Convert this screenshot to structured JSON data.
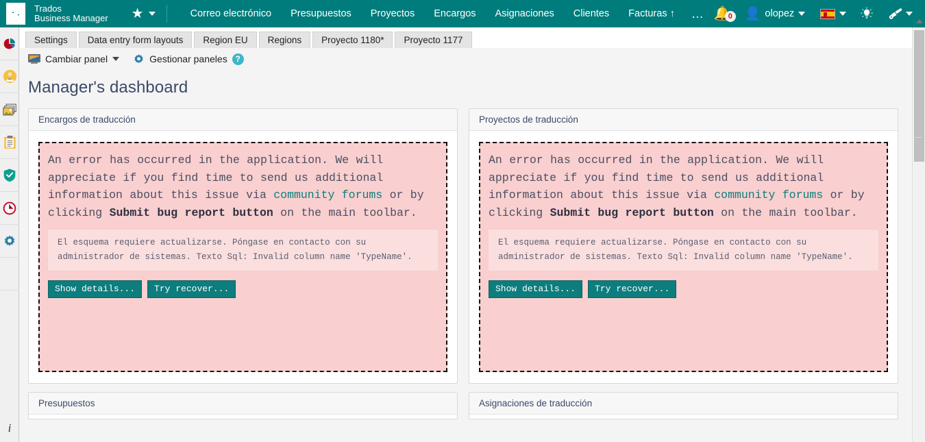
{
  "header": {
    "brand_line1": "Trados",
    "brand_line2": "Business Manager",
    "favorites_icon": "star-icon",
    "nav": [
      {
        "label": "Correo electrónico"
      },
      {
        "label": "Presupuestos"
      },
      {
        "label": "Proyectos"
      },
      {
        "label": "Encargos"
      },
      {
        "label": "Asignaciones"
      },
      {
        "label": "Clientes"
      },
      {
        "label": "Facturas ↑"
      }
    ],
    "overflow_label": "…",
    "notifications_count": "0",
    "username": "olopez",
    "language_flag": "spain-flag-icon",
    "idea_icon": "lightbulb-icon",
    "tools_icon": "paintbrush-icon",
    "help_icon": "question-mark-icon"
  },
  "sidebar": {
    "items": [
      {
        "name": "reports-pie-chart-icon"
      },
      {
        "name": "user-profile-icon"
      },
      {
        "name": "images-gallery-icon"
      },
      {
        "name": "clipboard-tasks-icon"
      },
      {
        "name": "shield-check-icon"
      },
      {
        "name": "clock-history-icon"
      },
      {
        "name": "settings-gear-icon"
      }
    ],
    "bottom_label": "i"
  },
  "tabs": [
    {
      "label": "Settings"
    },
    {
      "label": "Data entry form layouts"
    },
    {
      "label": "Region EU"
    },
    {
      "label": "Regions"
    },
    {
      "label": "Proyecto 1180*"
    },
    {
      "label": "Proyecto 1177"
    }
  ],
  "toolbar": {
    "change_panel_label": "Cambiar panel",
    "manage_panels_label": "Gestionar paneles",
    "help_label": "?"
  },
  "page": {
    "title": "Manager's dashboard"
  },
  "panels": {
    "top_left_title": "Encargos de traducción",
    "top_right_title": "Proyectos de traducción",
    "bottom_left_title": "Presupuestos",
    "bottom_right_title": "Asignaciones de traducción"
  },
  "error": {
    "text_part1": "An error has occurred in the application. We will appreciate if you find time to send us additional information about this issue via ",
    "link_text": "community forums",
    "text_part2": " or by clicking ",
    "bold_text": "Submit bug report button",
    "text_part3": " on the main toolbar.",
    "detail": "El esquema requiere actualizarse. Póngase en contacto con su administrador de sistemas. Texto Sql: Invalid column name 'TypeName'.",
    "show_details_label": "Show details...",
    "try_recover_label": "Try recover..."
  },
  "colors": {
    "brand_teal": "#007c7c",
    "error_bg": "#f9cfcf",
    "error_detail_bg": "#fbdede",
    "button_teal": "#0d7d7d",
    "title_blue": "#3a4a68"
  }
}
